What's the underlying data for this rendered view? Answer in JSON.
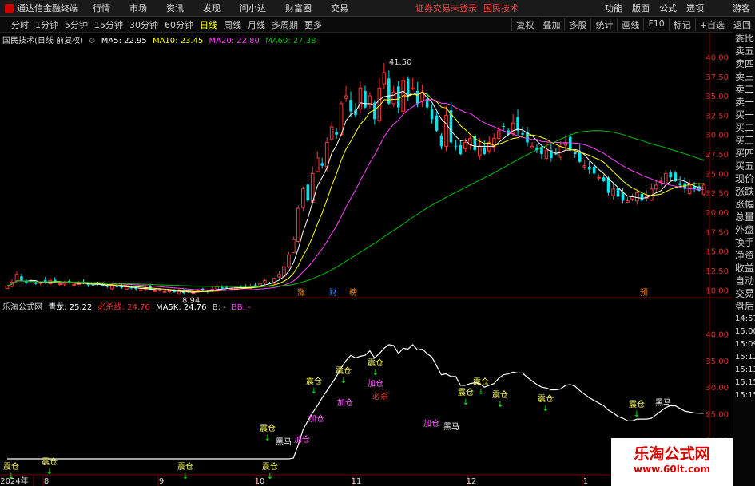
{
  "menubar": {
    "app": "通达信金融终端",
    "items": [
      "行情",
      "市场",
      "资讯",
      "发现",
      "问小达",
      "财富圈",
      "交易"
    ],
    "notice": "证券交易未登录",
    "stock": "国民技术",
    "right": [
      "功能",
      "版面",
      "公式",
      "选项"
    ],
    "user": "游客"
  },
  "toolbar": {
    "periods": [
      "分时",
      "1分钟",
      "5分钟",
      "15分钟",
      "30分钟",
      "60分钟",
      "日线",
      "周线",
      "月线",
      "多周期",
      "更多"
    ],
    "active": "日线",
    "right": [
      "复权",
      "叠加",
      "多股",
      "统计",
      "画线",
      "F10",
      "标记",
      "+自选",
      "返回"
    ]
  },
  "main_legend": {
    "title": "国民技术(日线 前复权)",
    "ma5": "MA5: 22.95",
    "ma10": "MA10: 23.45",
    "ma20": "MA20: 22.80",
    "ma60": "MA60: 27.38"
  },
  "sub_legend": {
    "title": "乐淘公式网",
    "qinglong": "青龙: 25.22",
    "bisha": "必杀线: 24.76",
    "ma5k": "MA5K: 24.76",
    "b": "B: -",
    "bb": "BB: -"
  },
  "side_labels": [
    "委比",
    "卖五",
    "卖四",
    "卖三",
    "卖二",
    "卖一",
    "买一",
    "买二",
    "买三",
    "买四",
    "买五",
    "现价",
    "涨跌",
    "涨幅",
    "总量",
    "外盘",
    "换手",
    "净资",
    "收益",
    "自动",
    "交易",
    "盘后",
    "14:57",
    "15:00",
    "15:09",
    "15:12",
    "15:13",
    "15:15",
    "15:15"
  ],
  "watermark": {
    "line1": "乐淘公式网",
    "line2": "www.60lt.com"
  },
  "colors": {
    "up": "#ff3232",
    "down": "#00e5ee",
    "ma5": "#ffffff",
    "ma10": "#ffff00",
    "ma20": "#ff40ff",
    "ma60": "#00c000"
  },
  "chart_data": [
    {
      "type": "candlestick",
      "title": "国民技术(日线 前复权)",
      "y_ticks": [
        40.0,
        37.5,
        35.0,
        32.5,
        30.0,
        27.5,
        25.0,
        22.5,
        20.0,
        17.5,
        15.0,
        12.5,
        10.0
      ],
      "ylim": [
        9.0,
        42.0
      ],
      "x_labels": [
        "2024年",
        "8",
        "9",
        "10",
        "11",
        "12",
        "1"
      ],
      "annotations": {
        "high": "41.50",
        "low": "8.94",
        "events": [
          "涨",
          "财",
          "榜",
          "预"
        ]
      },
      "closes": [
        10.5,
        11.0,
        12.0,
        11.2,
        10.9,
        11.1,
        10.8,
        11.0,
        10.9,
        11.2,
        11.0,
        10.8,
        11.0,
        10.9,
        10.7,
        10.8,
        10.9,
        10.6,
        10.6,
        10.8,
        10.5,
        10.4,
        10.5,
        10.4,
        10.3,
        10.4,
        10.2,
        10.1,
        10.0,
        10.2,
        10.0,
        9.9,
        10.0,
        9.8,
        9.9,
        9.7,
        9.8,
        9.6,
        9.7,
        9.7,
        9.9,
        10.0,
        9.8,
        10.1,
        10.4,
        10.2,
        10.3,
        10.1,
        10.3,
        10.5,
        10.2,
        10.4,
        10.6,
        10.8,
        11.2,
        10.9,
        11.5,
        12.0,
        13.0,
        14.5,
        16.5,
        20.5,
        23.0,
        21.5,
        25.0,
        27.0,
        26.0,
        29.0,
        31.0,
        30.0,
        34.0,
        35.0,
        33.0,
        32.5,
        36.0,
        33.5,
        35.0,
        32.0,
        36.0,
        38.0,
        34.0,
        35.5,
        33.5,
        37.0,
        35.0,
        36.0,
        34.0,
        35.5,
        33.5,
        32.0,
        30.5,
        28.5,
        32.5,
        29.0,
        28.5,
        27.5,
        29.0,
        29.5,
        28.0,
        28.5,
        27.5,
        29.0,
        29.5,
        30.5,
        31.0,
        30.0,
        31.5,
        30.5,
        30.0,
        29.0,
        28.5,
        28.0,
        27.5,
        28.0,
        27.0,
        27.5,
        28.5,
        29.0,
        28.0,
        27.5,
        26.5,
        26.0,
        25.5,
        25.0,
        24.5,
        24.0,
        22.5,
        23.0,
        22.0,
        21.5,
        21.5,
        22.0,
        22.5,
        21.5,
        22.0,
        23.0,
        23.5,
        24.0,
        25.0,
        24.5,
        24.0,
        23.5,
        23.0,
        23.5,
        23.0,
        22.8,
        23.5
      ],
      "series": [
        {
          "name": "MA5",
          "value": 22.95
        },
        {
          "name": "MA10",
          "value": 23.45
        },
        {
          "name": "MA20",
          "value": 22.8
        },
        {
          "name": "MA60",
          "value": 27.38
        }
      ]
    },
    {
      "type": "line",
      "title": "乐淘公式网",
      "y_ticks": [
        40.0,
        35.0,
        30.0,
        25.0,
        20.0
      ],
      "ylim": [
        13.5,
        44.0
      ],
      "series": [
        {
          "name": "青龙",
          "value": 25.22
        },
        {
          "name": "必杀线",
          "value": 24.76
        },
        {
          "name": "MA5K",
          "value": 24.76
        }
      ],
      "signals": [
        "震仓",
        "震仓",
        "震仓",
        "震仓",
        "震仓",
        "震仓",
        "震仓",
        "震仓",
        "震仓",
        "震仓",
        "震仓",
        "震仓",
        "震仓",
        "加仓",
        "加仓",
        "加仓",
        "加仓",
        "加仓",
        "黑马",
        "黑马",
        "黑马",
        "必杀"
      ]
    }
  ]
}
